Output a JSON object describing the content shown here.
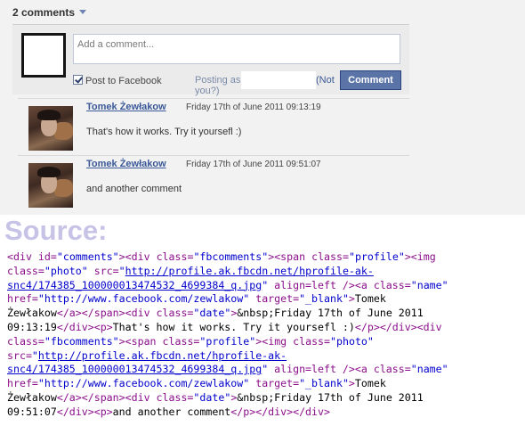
{
  "widget": {
    "comment_count_label": "2 comments",
    "input_placeholder": "Add a comment...",
    "post_to_facebook_label": "Post to Facebook",
    "posting_as_label": "Posting as you?)",
    "not_link_label": "(Not",
    "comment_button_label": "Comment"
  },
  "comments": [
    {
      "author": "Tomek Żewłakow",
      "date": "Friday 17th of June 2011 09:13:19",
      "text": "That's how it works. Try it yoursefl :)"
    },
    {
      "author": "Tomek Żewłakow",
      "date": "Friday 17th of June 2011 09:51:07",
      "text": "and another comment"
    }
  ],
  "source": {
    "title": "Source:",
    "lines": [
      [
        [
          "tag",
          "<div "
        ],
        [
          "tag",
          "id="
        ],
        [
          "val",
          "\"comments\""
        ],
        [
          "tag",
          "><div "
        ],
        [
          "tag",
          "class="
        ],
        [
          "val",
          "\"fbcomments\""
        ],
        [
          "tag",
          "><span "
        ],
        [
          "tag",
          "class="
        ],
        [
          "val",
          "\"profile\""
        ],
        [
          "tag",
          "><img"
        ]
      ],
      [
        [
          "tag",
          "class="
        ],
        [
          "val",
          "\"photo\""
        ],
        [
          "tag",
          " src="
        ],
        [
          "val",
          "\""
        ],
        [
          "url",
          "http://profile.ak.fbcdn.net/hprofile-ak-"
        ]
      ],
      [
        [
          "url",
          "snc4/174385_100000013474532_4699384_q.jpg"
        ],
        [
          "val",
          "\""
        ],
        [
          "tag",
          " align=left /><a "
        ],
        [
          "tag",
          "class="
        ],
        [
          "val",
          "\"name\""
        ]
      ],
      [
        [
          "tag",
          "href="
        ],
        [
          "val",
          "\"http://www.facebook.com/zewlakow\""
        ],
        [
          "tag",
          " target="
        ],
        [
          "val",
          "\"_blank\""
        ],
        [
          "tag",
          ">"
        ],
        [
          "txt",
          "Tomek"
        ]
      ],
      [
        [
          "txt",
          "Żewłakow"
        ],
        [
          "tag",
          "</a></span><div "
        ],
        [
          "tag",
          "class="
        ],
        [
          "val",
          "\"date\""
        ],
        [
          "tag",
          ">"
        ],
        [
          "txt",
          "&nbsp;Friday 17th of June 2011"
        ]
      ],
      [
        [
          "txt",
          "09:13:19"
        ],
        [
          "tag",
          "</div><p>"
        ],
        [
          "txt",
          "That's how it works. Try it yoursefl :)"
        ],
        [
          "tag",
          "</p></div><div"
        ]
      ],
      [
        [
          "tag",
          "class="
        ],
        [
          "val",
          "\"fbcomments\""
        ],
        [
          "tag",
          "><span "
        ],
        [
          "tag",
          "class="
        ],
        [
          "val",
          "\"profile\""
        ],
        [
          "tag",
          "><img "
        ],
        [
          "tag",
          "class="
        ],
        [
          "val",
          "\"photo\""
        ]
      ],
      [
        [
          "tag",
          "src="
        ],
        [
          "val",
          "\""
        ],
        [
          "url",
          "http://profile.ak.fbcdn.net/hprofile-ak-"
        ]
      ],
      [
        [
          "url",
          "snc4/174385_100000013474532_4699384_q.jpg"
        ],
        [
          "val",
          "\""
        ],
        [
          "tag",
          " align=left /><a "
        ],
        [
          "tag",
          "class="
        ],
        [
          "val",
          "\"name\""
        ]
      ],
      [
        [
          "tag",
          "href="
        ],
        [
          "val",
          "\"http://www.facebook.com/zewlakow\""
        ],
        [
          "tag",
          " target="
        ],
        [
          "val",
          "\"_blank\""
        ],
        [
          "tag",
          ">"
        ],
        [
          "txt",
          "Tomek"
        ]
      ],
      [
        [
          "txt",
          "Żewłakow"
        ],
        [
          "tag",
          "</a></span><div "
        ],
        [
          "tag",
          "class="
        ],
        [
          "val",
          "\"date\""
        ],
        [
          "tag",
          ">"
        ],
        [
          "txt",
          "&nbsp;Friday 17th of June 2011"
        ]
      ],
      [
        [
          "txt",
          "09:51:07"
        ],
        [
          "tag",
          "</div><p>"
        ],
        [
          "txt",
          "and another comment"
        ],
        [
          "tag",
          "</p></div></div>"
        ]
      ]
    ]
  },
  "colors": {
    "fb_blue": "#3b5998",
    "button_blue": "#5b74a8",
    "source_title": "#c7c3e7",
    "tag": "#8b0e8b",
    "value": "#0000cc"
  },
  "icons": {
    "dropdown": "chevron-down-icon",
    "checkbox": "checkbox-checked-icon"
  }
}
